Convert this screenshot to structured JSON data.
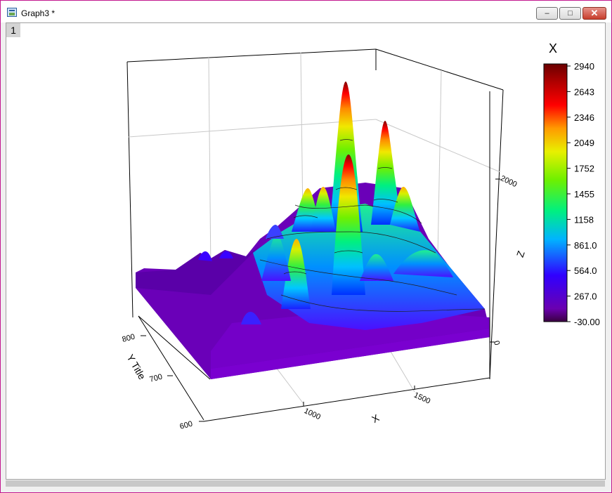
{
  "window": {
    "title": "Graph3 *",
    "layer_label": "1",
    "buttons": {
      "minimize": "–",
      "maximize": "□",
      "close": "✕"
    }
  },
  "chart_data": {
    "type": "surface-3d",
    "colormap": "rainbow",
    "axes": {
      "x": {
        "label": "X",
        "ticks": [
          "1000",
          "1500"
        ]
      },
      "y": {
        "label": "Y Title",
        "ticks": [
          "600",
          "700",
          "800"
        ]
      },
      "z": {
        "label": "Z",
        "ticks": [
          "0",
          "2000"
        ]
      }
    },
    "colorbar": {
      "title": "X",
      "levels": [
        "2940",
        "2643",
        "2346",
        "2049",
        "1752",
        "1455",
        "1158",
        "861.0",
        "564.0",
        "267.0",
        "-30.00"
      ]
    },
    "z_range": [
      -30,
      2940
    ],
    "grid": true
  }
}
